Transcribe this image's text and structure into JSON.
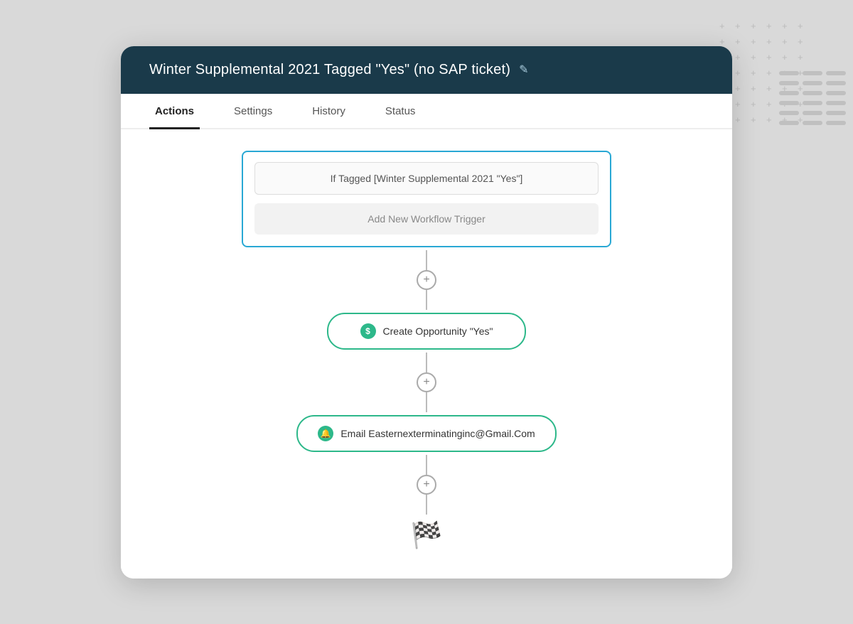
{
  "modal": {
    "title": "Winter Supplemental 2021 Tagged \"Yes\" (no SAP ticket)",
    "edit_icon": "✎"
  },
  "tabs": [
    {
      "id": "actions",
      "label": "Actions",
      "active": true
    },
    {
      "id": "settings",
      "label": "Settings",
      "active": false
    },
    {
      "id": "history",
      "label": "History",
      "active": false
    },
    {
      "id": "status",
      "label": "Status",
      "active": false
    }
  ],
  "trigger_box": {
    "condition_text": "If Tagged [Winter Supplemental 2021 \"Yes\"]",
    "add_trigger_label": "Add New Workflow Trigger"
  },
  "actions": [
    {
      "id": "create-opportunity",
      "icon_type": "dollar",
      "icon_symbol": "$",
      "label": "Create Opportunity \"Yes\""
    },
    {
      "id": "email-action",
      "icon_type": "bell",
      "icon_symbol": "🔔",
      "label": "Email Easternexterminatinginc@Gmail.Com"
    }
  ],
  "finish_symbol": "🏁",
  "colors": {
    "header_bg": "#1a3a4a",
    "tab_active_border": "#222",
    "trigger_border": "#29a8d4",
    "action_border": "#2db88a",
    "action_icon_bg": "#2db88a"
  }
}
